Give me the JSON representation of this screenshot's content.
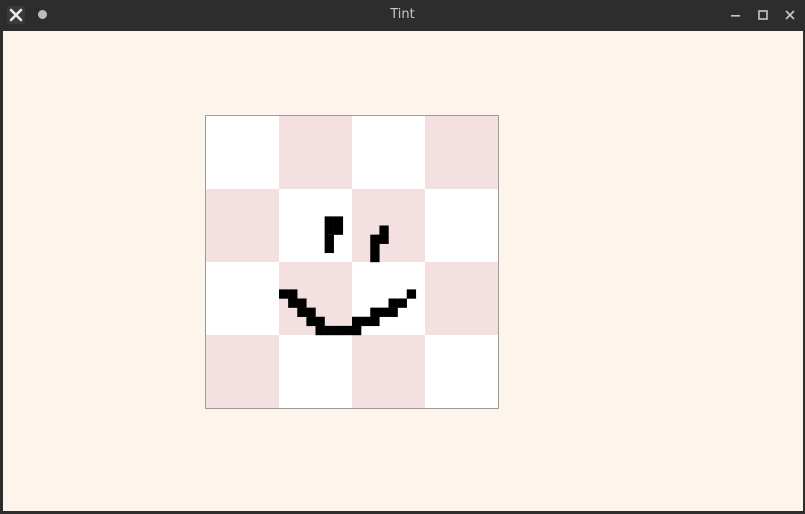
{
  "window": {
    "title": "Tint"
  },
  "icons": {
    "app": "x-app-icon",
    "sticky": "dot-icon",
    "minimize": "minimize-icon",
    "maximize": "maximize-icon",
    "close": "close-icon"
  },
  "colors": {
    "titlebar": "#2d2d2d",
    "background": "#fdf5ec",
    "checker_light": "#ffffff",
    "checker_dark": "#f4e0e0",
    "ink": "#000000"
  },
  "canvas": {
    "grid": [
      4,
      4
    ],
    "pixel_grid": 32
  }
}
